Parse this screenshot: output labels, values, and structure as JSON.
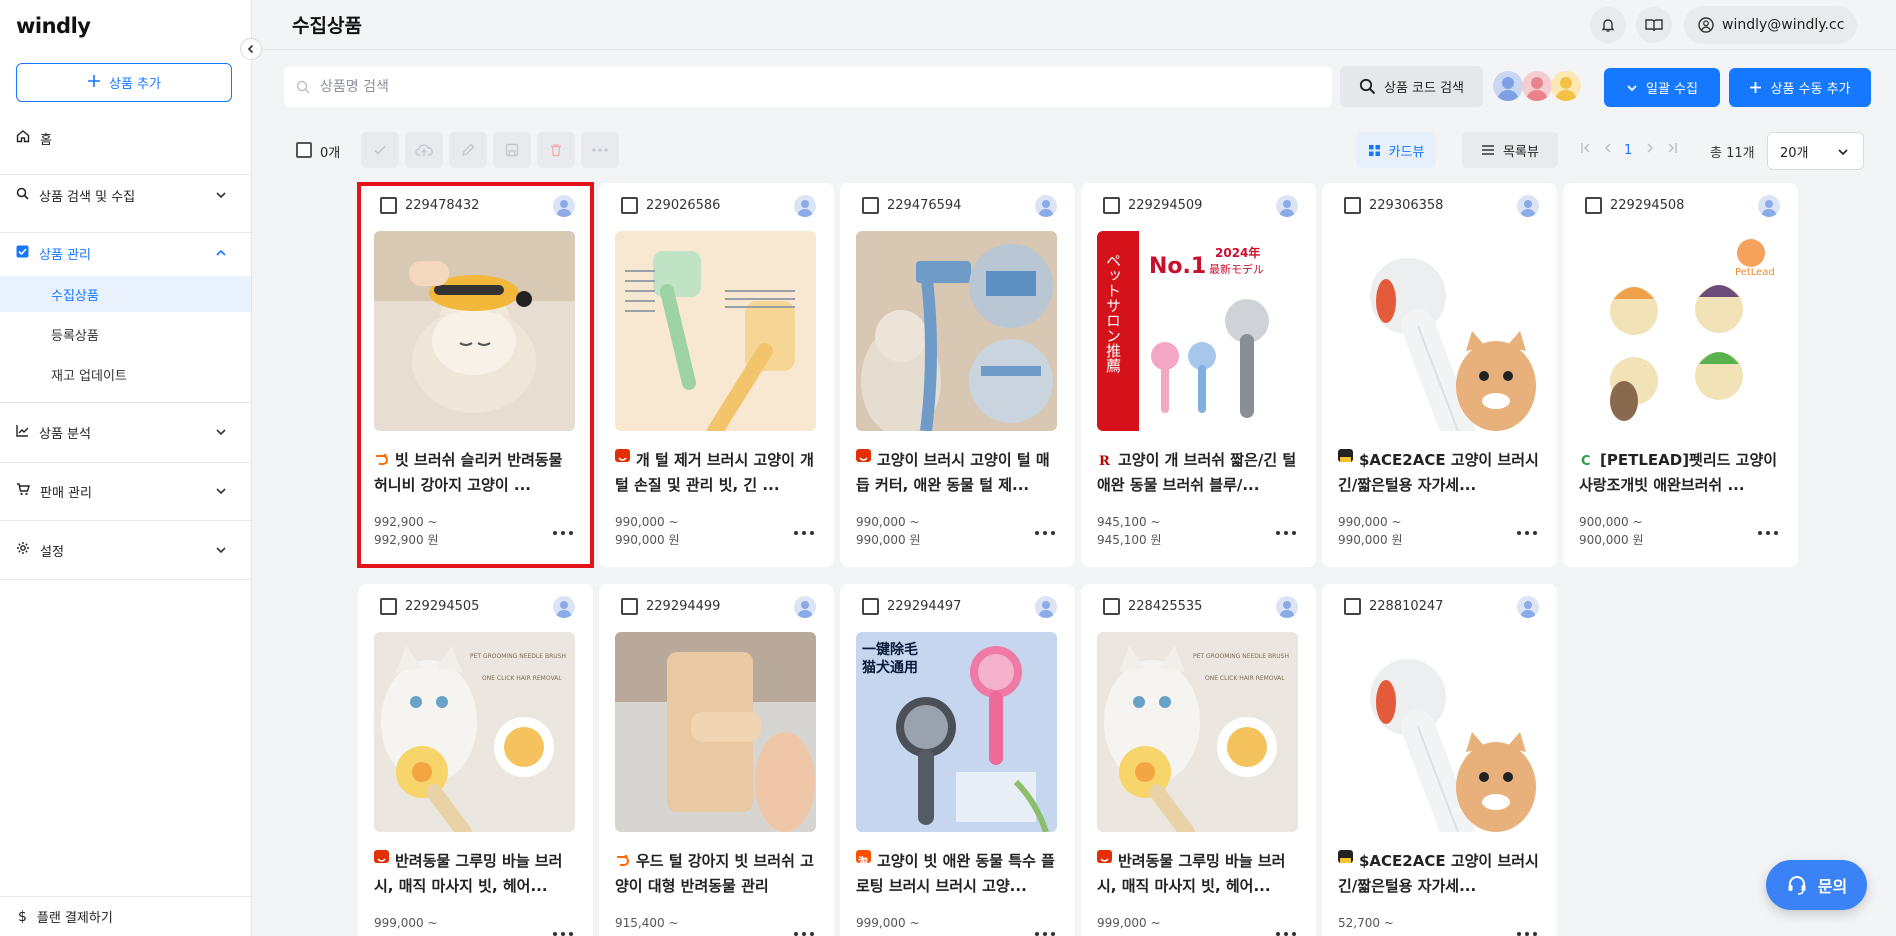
{
  "app": {
    "logo": "windly",
    "page_title": "수집상품",
    "user_email": "windly@windly.cc"
  },
  "sidebar": {
    "add_label": "상품 추가",
    "home": "홈",
    "search_collect": "상품 검색 및 수집",
    "product_mgmt": "상품 관리",
    "sub_items": [
      "수집상품",
      "등록상품",
      "재고 업데이트"
    ],
    "analysis": "상품 분석",
    "sales": "판매 관리",
    "settings": "설정",
    "plan": "플랜 결제하기"
  },
  "search": {
    "placeholder": "상품명 검색",
    "code_label": "상품 코드 검색"
  },
  "actions": {
    "bulk_collect": "일괄 수집",
    "manual_add": "상품 수동 추가"
  },
  "toolbar": {
    "selected_count": "0개",
    "card_view": "카드뷰",
    "list_view": "목록뷰",
    "page": "1",
    "total": "총 11개",
    "per_page": "20개"
  },
  "colors": {
    "accent": "#1677ff",
    "highlight": "#e4141b"
  },
  "products": [
    {
      "id": "229478432",
      "name": "빗 브러쉬 슬리커 반려동물 허니비 강아지 고양이 ...",
      "price_min": "992,900 ~",
      "price_max": "992,900 원",
      "source_color": "#ff6a00"
    },
    {
      "id": "229026586",
      "name": "개 털 제거 브러시 고양이 개 털 손질 및 관리 빗, 긴 ...",
      "price_min": "990,000 ~",
      "price_max": "990,000 원",
      "source_color": "#e62e04"
    },
    {
      "id": "229476594",
      "name": "고양이 브러시 고양이 털 매듭 커터, 애완 동물 털 제...",
      "price_min": "990,000 ~",
      "price_max": "990,000 원",
      "source_color": "#e62e04"
    },
    {
      "id": "229294509",
      "name": "고양이 개 브러쉬 짧은/긴 털 애완 동물 브러쉬 블루/...",
      "price_min": "945,100 ~",
      "price_max": "945,100 원",
      "source_color": "#bf0000"
    },
    {
      "id": "229306358",
      "name": "$ACE2ACE 고양이 브러시 긴/짧은털용 자가세...",
      "price_min": "990,000 ~",
      "price_max": "990,000 원",
      "source_color": "#222222"
    },
    {
      "id": "229294508",
      "name": "[PETLEAD]펫리드 고양이 사랑조개빗 애완브러쉬 ...",
      "price_min": "900,000 ~",
      "price_max": "900,000 원",
      "source_color": "#2e9e44"
    },
    {
      "id": "229294505",
      "name": "반려동물 그루밍 바늘 브러시, 매직 마사지 빗, 헤어...",
      "price_min": "999,000 ~",
      "price_max": "",
      "source_color": "#e62e04"
    },
    {
      "id": "229294499",
      "name": "우드 털 강아지 빗 브러쉬 고양이 대형 반려동물 관리",
      "price_min": "915,400 ~",
      "price_max": "",
      "source_color": "#ff6a00"
    },
    {
      "id": "229294497",
      "name": "고양이 빗 애완 동물 특수 플로팅 브러시 브러시 고양...",
      "price_min": "999,000 ~",
      "price_max": "",
      "source_color": "#ff5000"
    },
    {
      "id": "228425535",
      "name": "반려동물 그루밍 바늘 브러시, 매직 마사지 빗, 헤어...",
      "price_min": "999,000 ~",
      "price_max": "",
      "source_color": "#e62e04"
    },
    {
      "id": "228810247",
      "name": "$ACE2ACE 고양이 브러시 긴/짧은털용 자가세...",
      "price_min": "52,700 ~",
      "price_max": "",
      "source_color": "#222222"
    }
  ],
  "thumb_texts": {
    "p4_no1": "No.1",
    "p4_year": "2024年",
    "p4_model": "最新モデル",
    "p4_banner": "ペットサロン推薦",
    "p6_brand": "PetLead",
    "p7_line1": "PET GROOMING NEEDLE BRUSH",
    "p7_line2": "ONE CLICK HAIR REMOVAL",
    "p9_line1": "一键除毛",
    "p9_line2": "猫犬通用",
    "p10_line1": "PET GROOMING NEEDLE BRUSH",
    "p10_line2": "ONE CLICK HAIR REMOVAL"
  },
  "chat": {
    "label": "문의"
  }
}
